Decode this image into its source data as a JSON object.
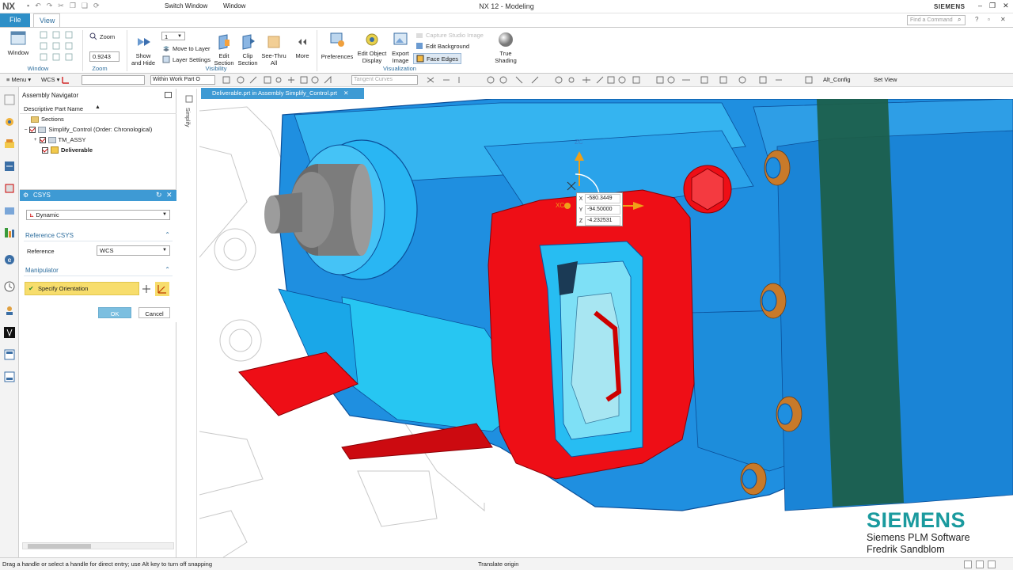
{
  "app": {
    "logo": "NX",
    "title": "NX 12 - Modeling",
    "brand_top": "SIEMENS",
    "switch_window": "Switch Window",
    "window_menu": "Window"
  },
  "tabs": {
    "file": "File",
    "view": "View"
  },
  "search": {
    "placeholder": "Find a Command"
  },
  "ribbon": {
    "window_btn": "Window",
    "zoom_btn": "Zoom",
    "zoom_value": "0.9243",
    "layer_value": "1",
    "show_hide": [
      "Show",
      "and Hide"
    ],
    "move_to_layer": "Move to Layer",
    "layer_settings": "Layer Settings",
    "edit_section": [
      "Edit",
      "Section"
    ],
    "clip_section": [
      "Clip",
      "Section"
    ],
    "see_thru": [
      "See-Thru",
      "All"
    ],
    "more": "More",
    "preferences": "Preferences",
    "edit_object_display": [
      "Edit Object",
      "Display"
    ],
    "export_image": [
      "Export",
      "Image"
    ],
    "capture_studio": "Capture Studio Image",
    "edit_background": "Edit Background",
    "face_edges": "Face Edges",
    "true_shading": [
      "True",
      "Shading"
    ],
    "groups": {
      "window": "Window",
      "zoom": "Zoom",
      "visibility": "Visibility",
      "visualization": "Visualization"
    }
  },
  "toolbar": {
    "menu": "Menu",
    "wcs": "WCS",
    "filter_scope": "Within Work Part O",
    "curve_rule": "Tangent Curves",
    "config": "Alt_Config",
    "set_view": "Set View"
  },
  "navigator": {
    "title": "Assembly Navigator",
    "column": "Descriptive Part Name",
    "rows": [
      "Sections",
      "Simplify_Control (Order: Chronological)",
      "TM_ASSY",
      "Deliverable"
    ]
  },
  "csys": {
    "title": "CSYS",
    "type": "Dynamic",
    "reference_section": "Reference CSYS",
    "reference_label": "Reference",
    "reference_value": "WCS",
    "manipulator_section": "Manipulator",
    "specify_orientation": "Specify Orientation",
    "ok": "OK",
    "cancel": "Cancel"
  },
  "resource_bar": {
    "simplify": "Simplify"
  },
  "doc_tab": "Deliverable.prt in Assembly Simplify_Control.prt",
  "coords": {
    "x": "-580.3449",
    "y": "-94.50000",
    "z": "-4.232531",
    "zc_label": "ZC",
    "xc_label": "XC"
  },
  "watermark": {
    "company": "SIEMENS",
    "line1": "Siemens PLM Software",
    "line2": "Fredrik Sandblom"
  },
  "status": {
    "message": "Drag a handle or select a handle for direct entry; use Alt key to turn off snapping",
    "mode": "Translate origin"
  },
  "colors": {
    "accent": "#3e9ad4",
    "model_blue": "#1f8fe0",
    "section_red": "#ee0e16",
    "brand": "#1a9a9e",
    "highlight": "#f7dd6c"
  }
}
